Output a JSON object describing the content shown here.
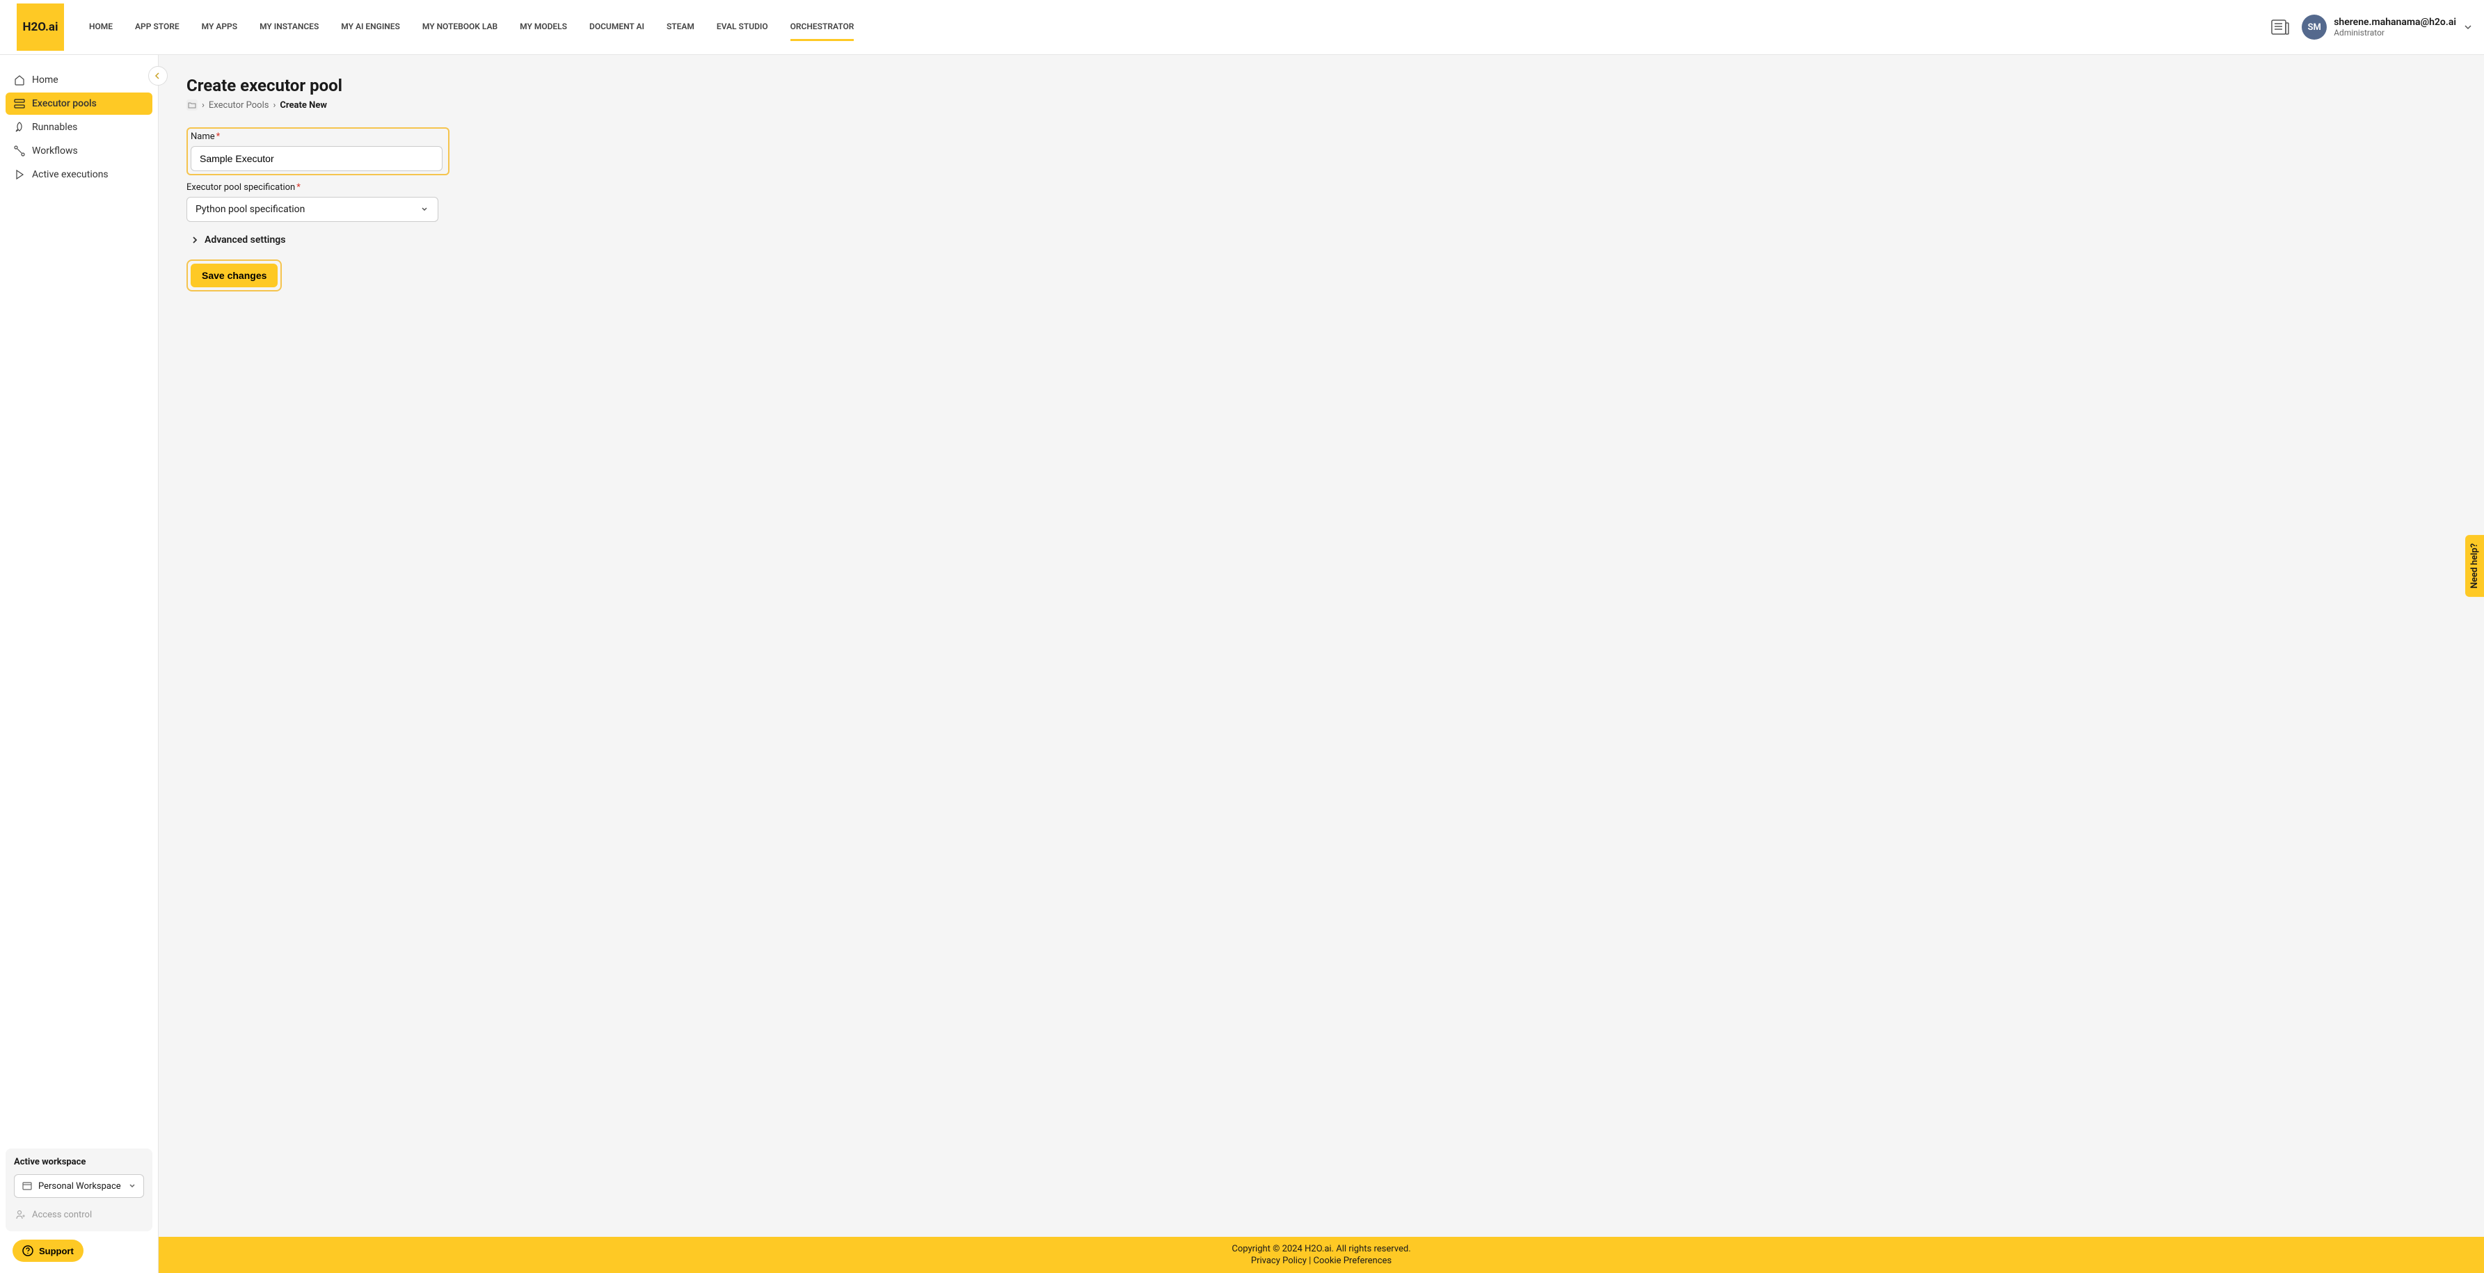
{
  "logo": "H2O.ai",
  "nav": [
    {
      "label": "HOME"
    },
    {
      "label": "APP STORE"
    },
    {
      "label": "MY APPS"
    },
    {
      "label": "MY INSTANCES"
    },
    {
      "label": "MY AI ENGINES"
    },
    {
      "label": "MY NOTEBOOK LAB"
    },
    {
      "label": "MY MODELS"
    },
    {
      "label": "DOCUMENT AI"
    },
    {
      "label": "STEAM"
    },
    {
      "label": "EVAL STUDIO"
    },
    {
      "label": "ORCHESTRATOR"
    }
  ],
  "user": {
    "initials": "SM",
    "email": "sherene.mahanama@h2o.ai",
    "role": "Administrator"
  },
  "sidebar": {
    "items": [
      {
        "label": "Home"
      },
      {
        "label": "Executor pools"
      },
      {
        "label": "Runnables"
      },
      {
        "label": "Workflows"
      },
      {
        "label": "Active executions"
      }
    ]
  },
  "workspace": {
    "title": "Active workspace",
    "selected": "Personal Workspace",
    "access": "Access control"
  },
  "support": "Support",
  "page": {
    "title": "Create executor pool",
    "breadcrumb": {
      "root": "Executor Pools",
      "current": "Create New"
    },
    "form": {
      "name_label": "Name",
      "name_value": "Sample Executor",
      "spec_label": "Executor pool specification",
      "spec_value": "Python pool specification",
      "advanced": "Advanced settings",
      "save": "Save changes"
    }
  },
  "footer": {
    "copyright": "Copyright © 2024 H2O.ai. All rights reserved.",
    "privacy": "Privacy Policy",
    "cookie": "Cookie Preferences"
  },
  "help": "Need help?"
}
